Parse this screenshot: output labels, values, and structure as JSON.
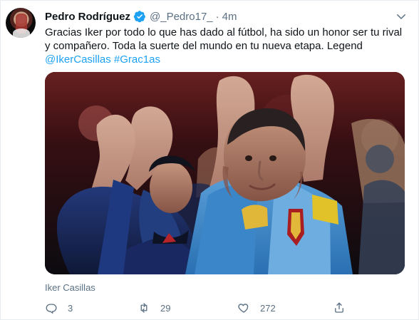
{
  "tweet": {
    "author_name": "Pedro Rodríguez",
    "handle": "@_Pedro17_",
    "separator": "·",
    "time": "4m",
    "text_line_1": "Gracias Iker por todo lo que has dado al fútbol, ha sido un honor ser tu rival",
    "text_line_2": "y compañero. Toda la suerte del mundo en tu nueva etapa. Legend",
    "mention": "@IkerCasillas",
    "hashtag": "#Grac1as",
    "media_label": "Iker Casillas",
    "stats": {
      "replies": "3",
      "retweets": "29",
      "likes": "272"
    }
  },
  "colors": {
    "link": "#1da1f2",
    "secondary_text": "#5b7083",
    "verified": "#1da1f2",
    "border": "#e6ecf0"
  },
  "icons": {
    "verified": "verified-badge-icon",
    "menu": "chevron-down-icon",
    "reply": "reply-icon",
    "retweet": "retweet-icon",
    "like": "heart-icon",
    "share": "share-icon"
  }
}
